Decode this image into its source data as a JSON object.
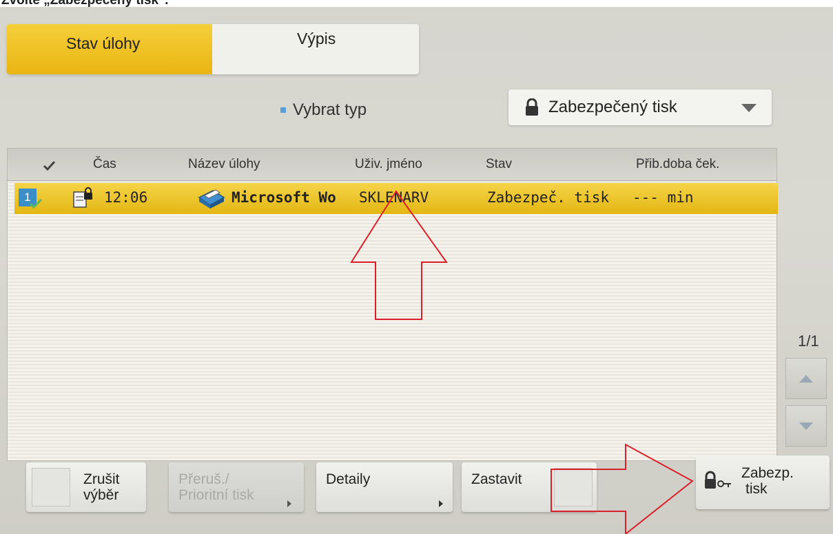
{
  "caption": "Zvolte „Zabezpečený tisk\".",
  "tabs": [
    {
      "label": "Stav úlohy",
      "active": true
    },
    {
      "label": "Výpis",
      "active": false
    }
  ],
  "filter": {
    "label": "Vybrat typ",
    "selected": "Zabezpečený tisk"
  },
  "table": {
    "columns": [
      "Čas",
      "Název úlohy",
      "Uživ. jméno",
      "Stav",
      "Přib.doba ček."
    ],
    "rows": [
      {
        "number": "1",
        "time": "12:06",
        "job_name": "Microsoft Wo",
        "user": "SKLENARV",
        "status": "Zabezpeč. tisk",
        "wait": "--- min"
      }
    ]
  },
  "pager": {
    "text": "1/1"
  },
  "buttons": {
    "clear_line1": "Zrušit",
    "clear_line2": "výběr",
    "interrupt_line1": "Přeruš./",
    "interrupt_line2": "Prioritní tisk",
    "details": "Detaily",
    "stop": "Zastavit",
    "secure_line1": "Zabezp.",
    "secure_line2": "tisk"
  },
  "colors": {
    "accent_yellow": "#f2c724",
    "annotation_red": "#d9202a",
    "panel_bg": "#d6d6cf"
  },
  "icons": {
    "header_check": "checkmark-icon",
    "row_number": "number-badge-icon",
    "row_lock": "locked-document-icon",
    "row_printer": "printer-icon",
    "select_lock": "lock-icon",
    "secure_button": "key-lock-icon"
  }
}
